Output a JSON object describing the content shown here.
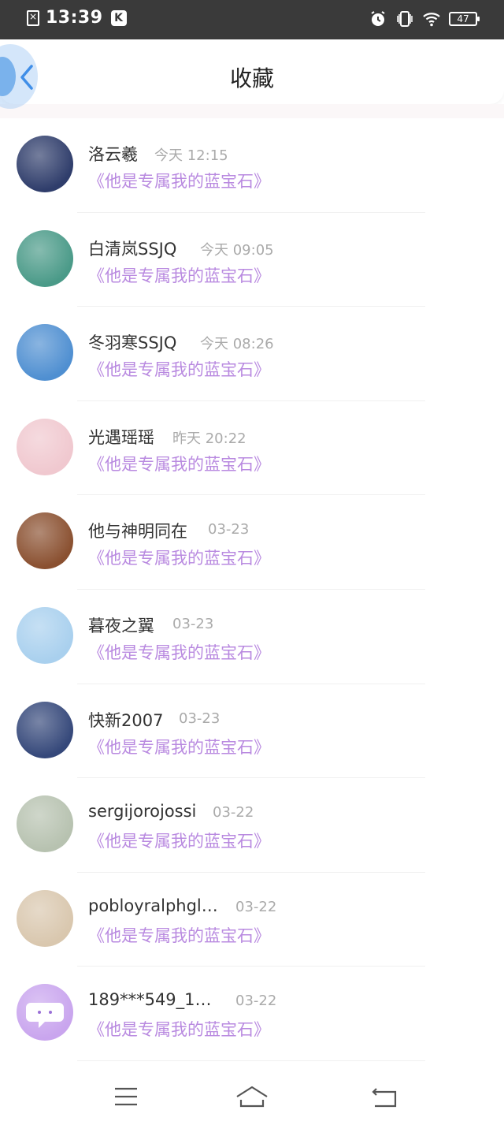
{
  "status_bar": {
    "time": "13:39",
    "k_badge": "K",
    "battery": "47",
    "icons": [
      "file-x-icon",
      "alarm-icon",
      "vibrate-icon",
      "wifi-icon",
      "battery-icon"
    ]
  },
  "header": {
    "title": "收藏",
    "back_icon": "chevron-left-icon"
  },
  "favorites": [
    {
      "name": "洛云羲",
      "time": "今天 12:15",
      "book": "《他是专属我的蓝宝石》",
      "avatar_color": "#2f3d6b"
    },
    {
      "name": "白清岚SSJQ",
      "time": "今天 09:05",
      "book": "《他是专属我的蓝宝石》",
      "avatar_color": "#4a9a88"
    },
    {
      "name": "冬羽寒SSJQ",
      "time": "今天 08:26",
      "book": "《他是专属我的蓝宝石》",
      "avatar_color": "#4f8fd1"
    },
    {
      "name": "光遇瑶瑶",
      "time": "昨天 20:22",
      "book": "《他是专属我的蓝宝石》",
      "avatar_color": "#f0c8cf"
    },
    {
      "name": "他与神明同在",
      "time": "03-23",
      "book": "《他是专属我的蓝宝石》",
      "avatar_color": "#8a5030"
    },
    {
      "name": "暮夜之翼",
      "time": "03-23",
      "book": "《他是专属我的蓝宝石》",
      "avatar_color": "#a9d0ee"
    },
    {
      "name": "快新2007",
      "time": "03-23",
      "book": "《他是专属我的蓝宝石》",
      "avatar_color": "#35487a"
    },
    {
      "name": "sergijorojossi",
      "time": "03-22",
      "book": "《他是专属我的蓝宝石》",
      "avatar_color": "#b7c2b0"
    },
    {
      "name": "pobloyralphgl…",
      "time": "03-22",
      "book": "《他是专属我的蓝宝石》",
      "avatar_color": "#d9c7ae"
    },
    {
      "name": "189***549_1…",
      "time": "03-22",
      "book": "《他是专属我的蓝宝石》",
      "avatar_color": "#c9a5ee"
    }
  ],
  "nav_bar": {
    "icons": [
      "menu-icon",
      "home-icon",
      "back-icon"
    ]
  },
  "colors": {
    "status_bar_bg": "#3a3a3a",
    "book_title": "#b98ae0",
    "accent_blue": "#3f8ee8"
  }
}
